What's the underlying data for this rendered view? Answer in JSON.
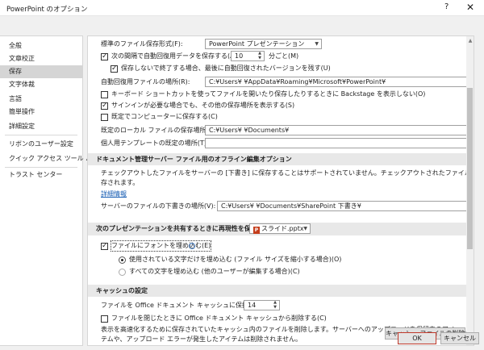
{
  "window": {
    "title": "PowerPoint のオプション",
    "help_label": "?",
    "close_label": "✕"
  },
  "sidebar": {
    "items": [
      {
        "label": "全般"
      },
      {
        "label": "文章校正"
      },
      {
        "label": "保存"
      },
      {
        "label": "文字体裁"
      },
      {
        "label": "言語"
      },
      {
        "label": "簡単操作"
      },
      {
        "label": "詳細設定"
      },
      {
        "label": "リボンのユーザー設定"
      },
      {
        "label": "クイック アクセス ツール バー"
      },
      {
        "label": "トラスト センター"
      }
    ]
  },
  "save": {
    "format_label": "標準のファイル保存形式(F):",
    "format_value": "PowerPoint プレゼンテーション",
    "autorecover_label": "次の間隔で自動回復用データを保存する(A):",
    "autorecover_minutes": "10",
    "minutes_unit": "分ごと(M)",
    "keep_last_label": "保存しないで終了する場合、最後に自動回復されたバージョンを残す(U)",
    "autorecover_location_label": "自動回復用ファイルの場所(R):",
    "autorecover_location_value": "C:¥Users¥        ¥AppData¥Roaming¥Microsoft¥PowerPoint¥",
    "backstage_label": "キーボード ショートカットを使ってファイルを開いたり保存したりするときに Backstage を表示しない(O)",
    "show_locations_label": "サインインが必要な場合でも、その他の保存場所を表示する(S)",
    "save_to_computer_label": "既定でコンピューターに保存する(C)",
    "default_local_label": "既定のローカル ファイルの保存場所(I):",
    "default_local_value": "C:¥Users¥        ¥Documents¥",
    "templates_label": "個人用テンプレートの既定の場所(T):",
    "templates_value": ""
  },
  "offline": {
    "heading": "ドキュメント管理サーバー ファイル用のオフライン編集オプション",
    "description_line1": "チェックアウトしたファイルをサーバーの [下書き] に保存することはサポートされていません。チェックアウトされたファイルは Office ドキュメント キャッシュに保",
    "description_line2": "存されます。",
    "details_link": "詳細情報",
    "drafts_label": "サーバーのファイルの下書きの場所(V):",
    "drafts_value": "C:¥Users¥        ¥Documents¥SharePoint 下書き¥"
  },
  "fidelity": {
    "heading": "次のプレゼンテーションを共有するときに再現性を保つ(D):",
    "file_name": "スライド.pptx",
    "file_icon": "powerpoint-file-icon",
    "embed_fonts_label": "ファイルにフォントを埋め込む(E)",
    "embed_used_label": "使用されている文字だけを埋め込む (ファイル サイズを縮小する場合)(O)",
    "embed_all_label": "すべての文字を埋め込む (他のユーザーが編集する場合)(C)"
  },
  "cache": {
    "heading": "キャッシュの設定",
    "days_label": "ファイルを Office ドキュメント キャッシュに保持する日数:",
    "days_value": "14",
    "delete_on_close_label": "ファイルを閉じたときに Office ドキュメント キャッシュから削除する(C)",
    "note_line1": "表示を高速化するために保存されていたキャッシュ内のファイルを削除します。サーバーへのアップロードを保留中のアイ",
    "note_line2": "テムや、アップロード エラーが発生したアイテムは削除されません。",
    "delete_cache_button": "キャッシュ ファイルの削除(D)"
  },
  "footer": {
    "ok_label": "OK",
    "cancel_label": "キャンセル"
  }
}
